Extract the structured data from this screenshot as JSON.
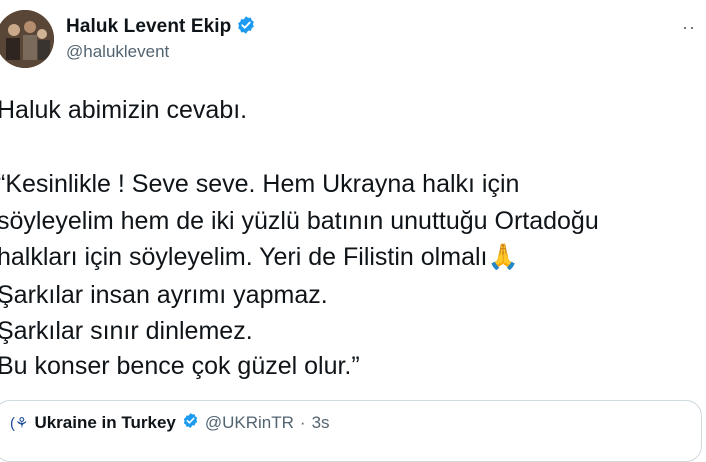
{
  "author": {
    "display_name": "Haluk Levent Ekip",
    "handle": "@haluklevent",
    "verified": true
  },
  "more_icon": "more-horizontal-icon",
  "tweet": {
    "lines": [
      "Haluk abimizin cevabı.",
      "",
      "“Kesinlikle ! Seve seve. Hem Ukrayna halkı için",
      "söyleyelim hem de iki yüzlü batının unuttuğu Ortadoğu",
      "halkları için söyleyelim. Yeri de Filistin olmalı",
      "Şarkılar insan ayrımı yapmaz.",
      "Şarkılar sınır dinlemez.",
      "Bu konser bence çok güzel olur.”"
    ],
    "emoji": "🙏"
  },
  "quoted": {
    "display_name": "Ukraine in Turkey",
    "handle": "@UKRinTR",
    "separator": "·",
    "time": "3s"
  },
  "colors": {
    "text": "#0f1419",
    "secondary": "#536471",
    "verified": "#1d9bf0",
    "border": "#cfd9de"
  }
}
